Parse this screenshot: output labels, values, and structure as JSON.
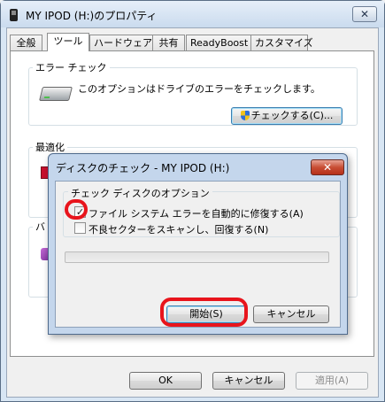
{
  "window": {
    "title": "MY IPOD (H:)のプロパティ",
    "close_glyph": "✕"
  },
  "tabs": [
    {
      "label": "全般",
      "active": false
    },
    {
      "label": "ツール",
      "active": true
    },
    {
      "label": "ハードウェア",
      "active": false
    },
    {
      "label": "共有",
      "active": false
    },
    {
      "label": "ReadyBoost",
      "active": false
    },
    {
      "label": "カスタマイズ",
      "active": false
    }
  ],
  "tools": {
    "error_check": {
      "title": "エラー チェック",
      "description": "このオプションはドライブのエラーをチェックします。",
      "button_label": "チェックする(C)...",
      "icon": "drive-icon"
    },
    "defrag": {
      "title": "最適化"
    },
    "backup": {
      "title": "バ"
    }
  },
  "footer": {
    "ok_label": "OK",
    "cancel_label": "キャンセル",
    "apply_label": "適用(A)"
  },
  "dialog": {
    "title": "ディスクのチェック - MY IPOD (H:)",
    "close_glyph": "✕",
    "options_title": "チェック ディスクのオプション",
    "options": [
      {
        "label": "ファイル システム エラーを自動的に修復する(A)",
        "checked": true,
        "check_glyph": "✓"
      },
      {
        "label": "不良セクターをスキャンし、回復する(N)",
        "checked": false,
        "check_glyph": ""
      }
    ],
    "progress": 0,
    "start_label": "開始(S)",
    "cancel_label": "キャンセル"
  },
  "colors": {
    "highlight": "#e8141c",
    "title_gradient": "#cadbee"
  }
}
